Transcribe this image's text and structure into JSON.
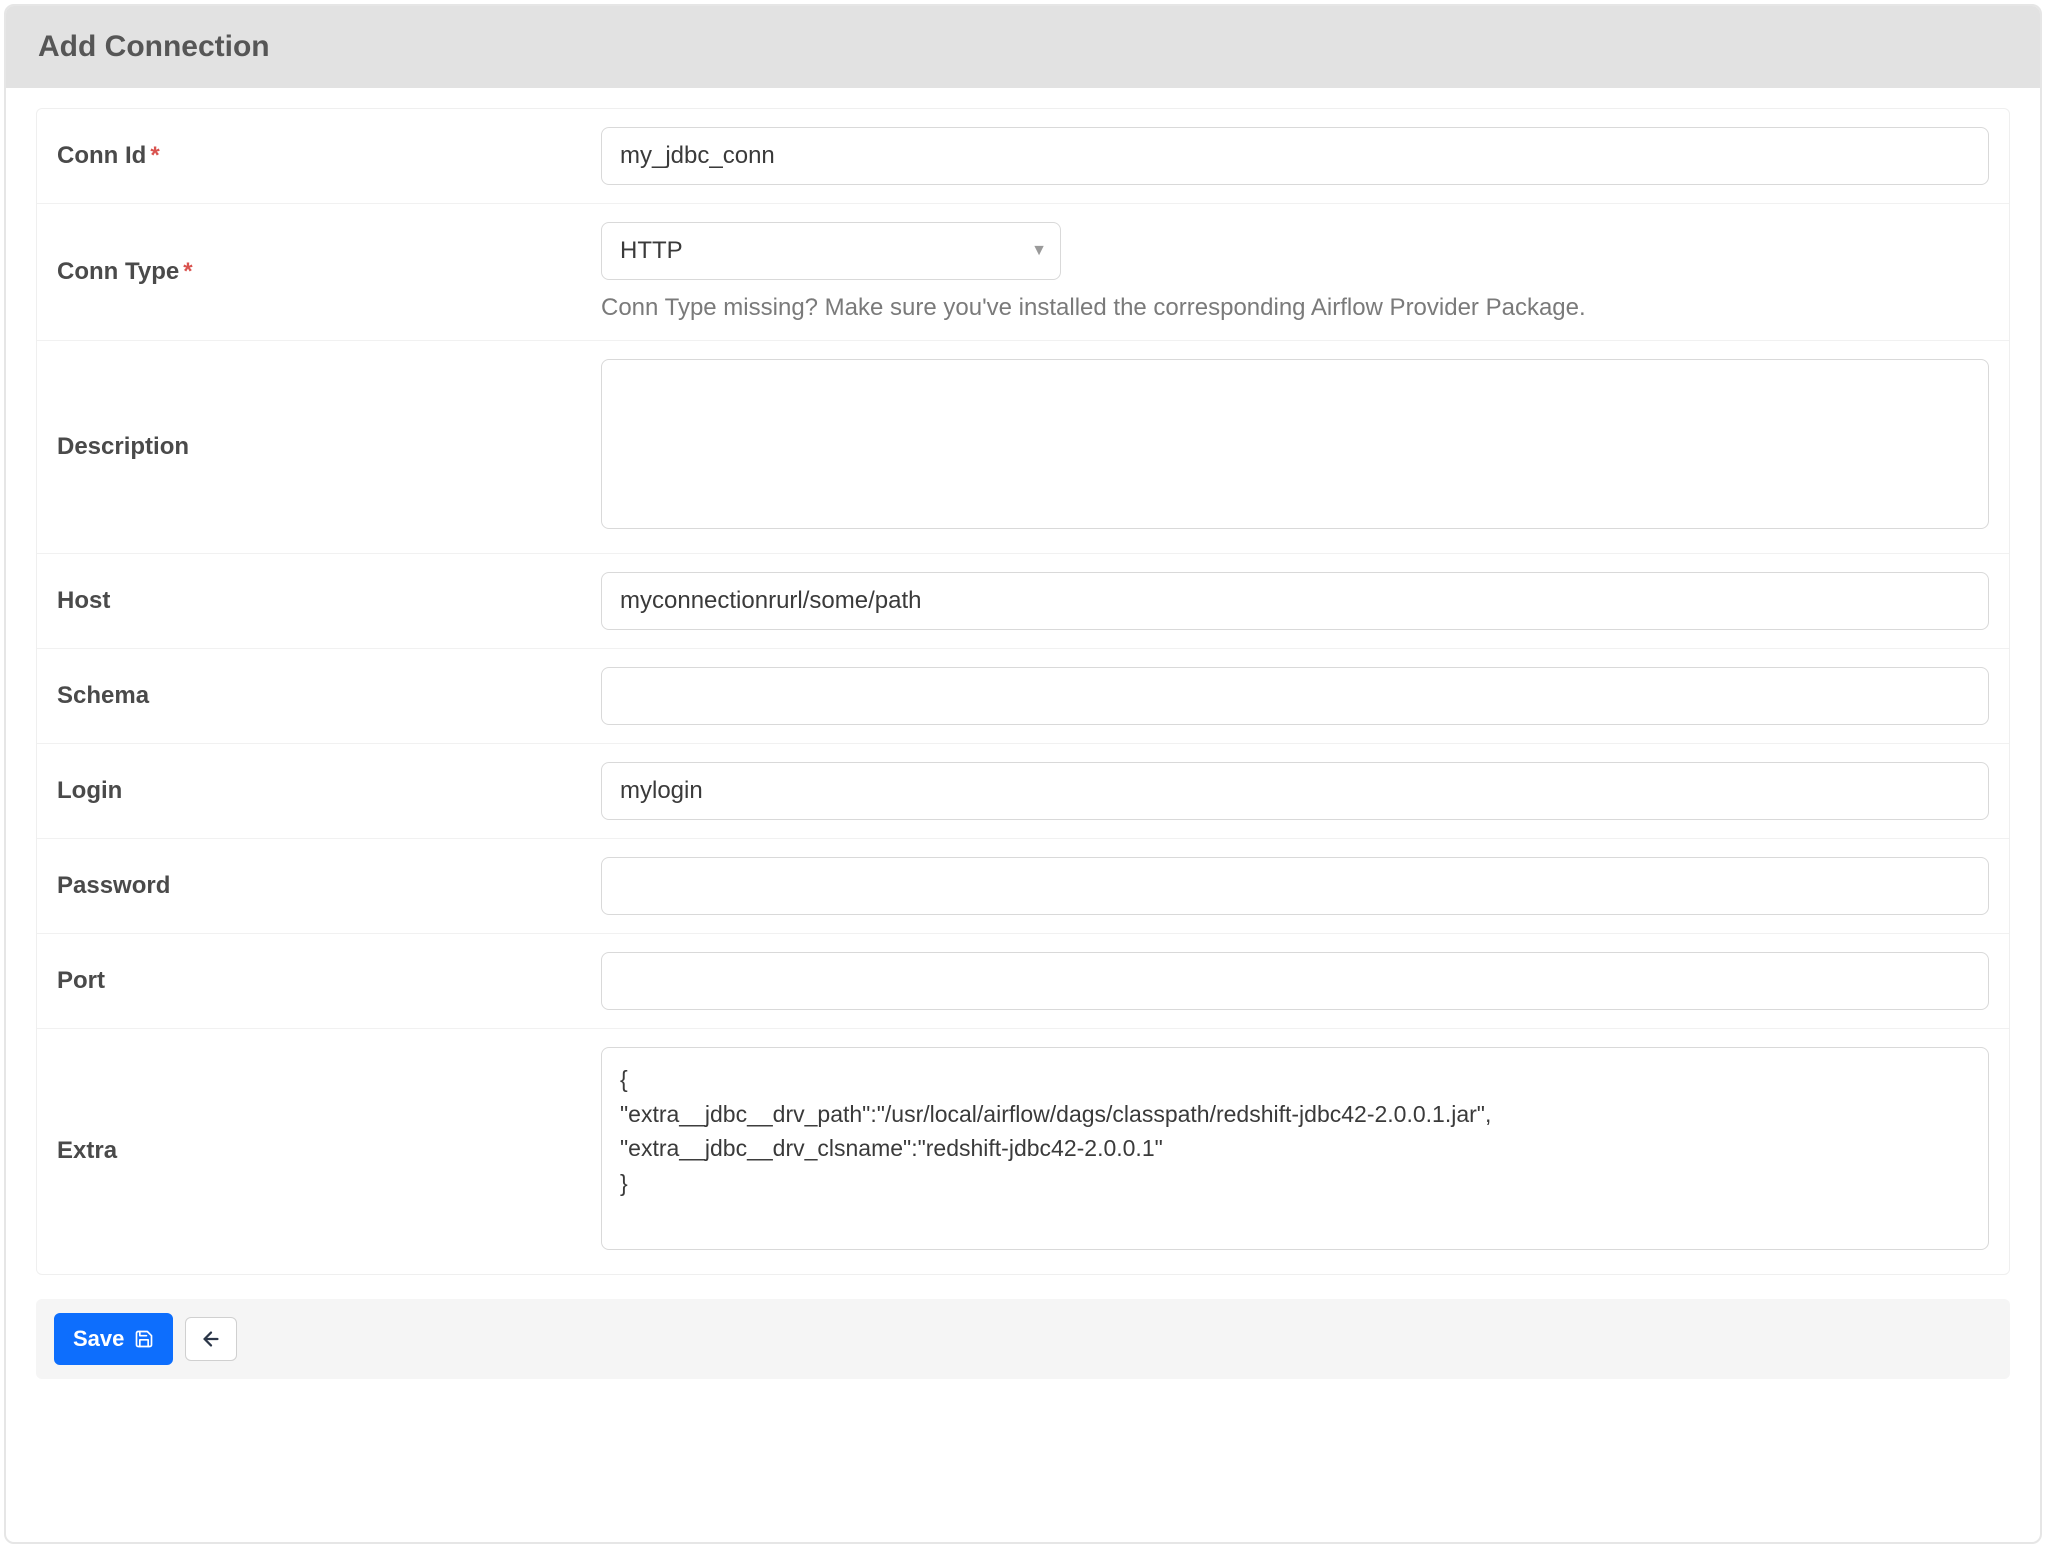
{
  "header": {
    "title": "Add Connection"
  },
  "form": {
    "conn_id": {
      "label": "Conn Id",
      "required": true,
      "value": "my_jdbc_conn"
    },
    "conn_type": {
      "label": "Conn Type",
      "required": true,
      "selected": "HTTP",
      "help": "Conn Type missing? Make sure you've installed the corresponding Airflow Provider Package."
    },
    "description": {
      "label": "Description",
      "value": ""
    },
    "host": {
      "label": "Host",
      "value": "myconnectionrurl/some/path"
    },
    "schema": {
      "label": "Schema",
      "value": ""
    },
    "login": {
      "label": "Login",
      "value": "mylogin"
    },
    "password": {
      "label": "Password",
      "value": ""
    },
    "port": {
      "label": "Port",
      "value": ""
    },
    "extra": {
      "label": "Extra",
      "value": "{\n\"extra__jdbc__drv_path\":\"/usr/local/airflow/dags/classpath/redshift-jdbc42-2.0.0.1.jar\",\n\"extra__jdbc__drv_clsname\":\"redshift-jdbc42-2.0.0.1\"\n}"
    }
  },
  "footer": {
    "save_label": "Save",
    "back_label": "Back"
  },
  "required_marker": "*"
}
